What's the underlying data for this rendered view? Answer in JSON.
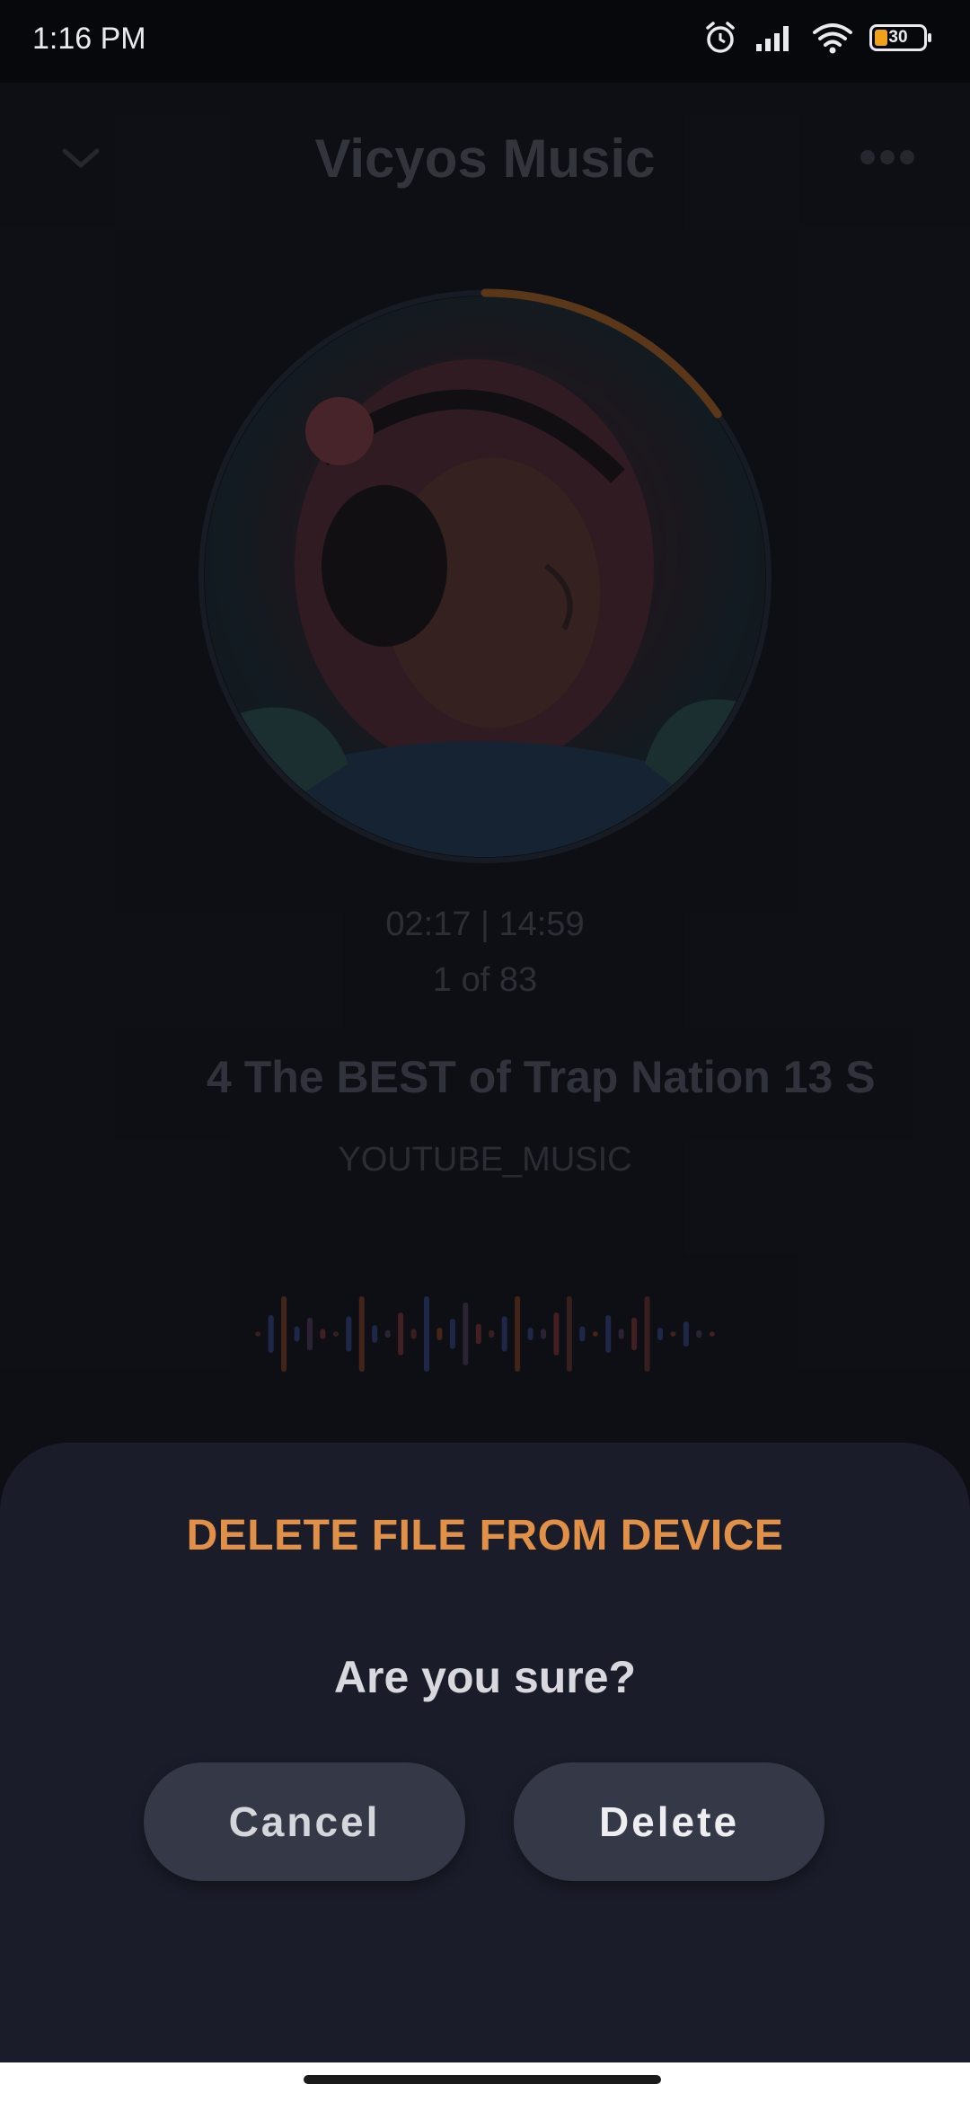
{
  "status_bar": {
    "time": "1:16 PM",
    "battery_level": "30",
    "icons": [
      "alarm-icon",
      "signal-icon",
      "wifi-icon",
      "battery-icon"
    ]
  },
  "player": {
    "title": "Vicyos Music",
    "time_readout": "02:17 | 14:59",
    "track_index": "1 of 83",
    "track_title": "4 The BEST of Trap Nation 13  S",
    "track_source": "YOUTUBE_MUSIC",
    "playback_progress": 0.153
  },
  "dialog": {
    "title": "DELETE FILE FROM DEVICE",
    "question": "Are you sure?",
    "cancel_label": "Cancel",
    "delete_label": "Delete"
  },
  "colors": {
    "accent": "#e19047",
    "sheet_background": "#1a1c29",
    "button_background": "#353846"
  }
}
